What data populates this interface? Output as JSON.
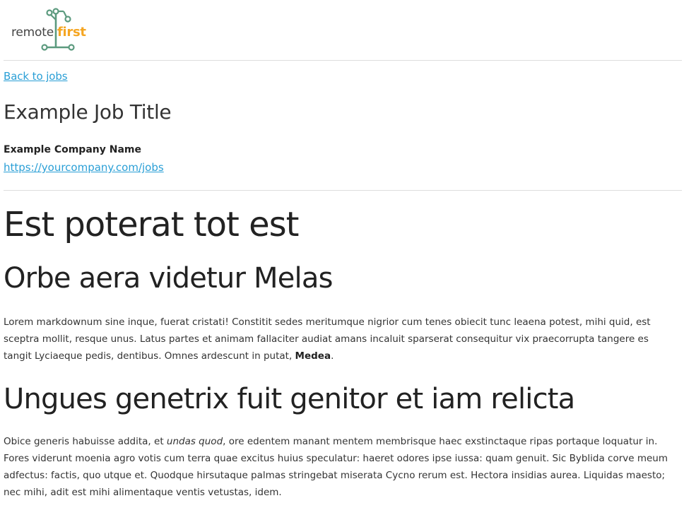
{
  "header": {
    "logo": {
      "word_remote": "remote",
      "word_first": "first",
      "accent_color": "#f5a623",
      "circuit_color": "#5b9a7e"
    }
  },
  "nav": {
    "back_label": "Back to jobs"
  },
  "job": {
    "title": "Example Job Title",
    "company_name": "Example Company Name",
    "company_url": "https://yourcompany.com/jobs"
  },
  "content": {
    "h1": "Est poterat tot est",
    "section1": {
      "heading": "Orbe aera videtur Melas",
      "paragraph_before_bold": "Lorem markdownum sine inque, fuerat cristati! Constitit sedes meritumque nigrior cum tenes obiecit tunc leaena potest, mihi quid, est sceptra mollit, resque unus. Latus partes et animam fallaciter audiat amans incaluit sparserat consequitur vix praecorrupta tangere es tangit Lyciaeque pedis, dentibus. Omnes ardescunt in putat, ",
      "paragraph_bold": "Medea",
      "paragraph_after_bold": "."
    },
    "section2": {
      "heading": "Ungues genetrix fuit genitor et iam relicta",
      "paragraph_before_em": "Obice generis habuisse addita, et ",
      "paragraph_em": "undas quod",
      "paragraph_after_em": ", ore edentem manant mentem membrisque haec exstinctaque ripas portaque loquatur in. Fores viderunt moenia agro votis cum terra quae excitus huius speculatur: haeret odores ipse iussa: quam genuit. Sic Byblida corve meum adfectus: factis, quo utque et. Quodque hirsutaque palmas stringebat miserata Cycno rerum est. Hectora insidias aurea. Liquidas maesto; nec mihi, adit est mihi alimentaque ventis vetustas, idem."
    }
  },
  "colors": {
    "link": "#2a9fd6",
    "text": "#333333",
    "divider": "#dddddd"
  }
}
